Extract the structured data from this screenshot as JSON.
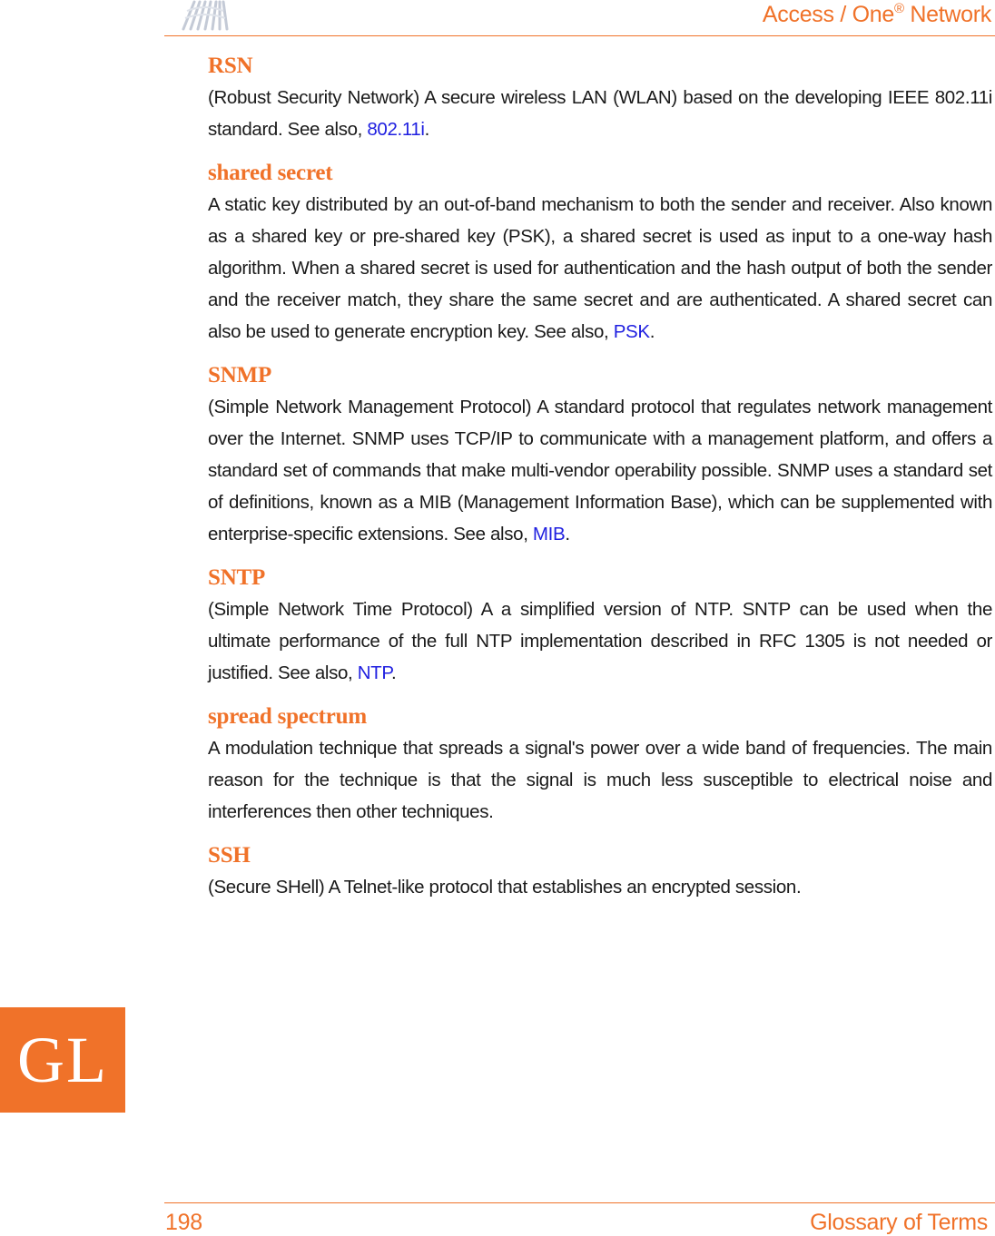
{
  "header": {
    "logo_icon": "fan-wave-logo-icon",
    "title_prefix": "Access / One",
    "title_mark": "®",
    "title_suffix": " Network"
  },
  "entries": [
    {
      "term": "RSN",
      "text": "(Robust Security Network) A secure wireless LAN (WLAN) based on the developing IEEE 802.11i standard. See also, ",
      "link": "802.11i",
      "tail": "."
    },
    {
      "term": "shared secret",
      "text": "A static key distributed by an out-of-band mechanism to both the sender and receiver. Also known as a shared key or pre-shared key (PSK), a shared secret is used as input to a one-way hash algorithm. When a shared secret is used for authentication and the hash output of both the sender and the receiver match, they share the same secret and are authenticated. A shared secret can also be used to generate encryption key. See also, ",
      "link": "PSK",
      "tail": "."
    },
    {
      "term": "SNMP",
      "text": "(Simple Network Management Protocol) A standard protocol that regulates network management over the Internet. SNMP uses TCP/IP to communicate with a management platform, and offers a standard set of commands that make multi-vendor operability possible. SNMP uses a standard set of definitions, known as a MIB (Management Information Base), which can be supplemented with enterprise-specific extensions. See also, ",
      "link": "MIB",
      "tail": "."
    },
    {
      "term": "SNTP",
      "text": "(Simple Network Time Protocol) A a simplified version of NTP. SNTP can be used when the ultimate performance of the full NTP implementation described in RFC 1305 is not needed or justified. See also, ",
      "link": "NTP",
      "tail": "."
    },
    {
      "term": "spread spectrum",
      "text": "A modulation technique that spreads a signal's power over a wide band of frequencies. The main reason for the technique is that the signal is much less susceptible to electrical noise and interferences then other techniques.",
      "link": null,
      "tail": ""
    },
    {
      "term": "SSH",
      "text": "(Secure SHell) A Telnet-like protocol that establishes an encrypted session.",
      "link": null,
      "tail": ""
    }
  ],
  "side_tab": {
    "label": "GL"
  },
  "footer": {
    "page_number": "198",
    "section": "Glossary of Terms"
  },
  "colors": {
    "accent": "#f07229",
    "link": "#1f1fe0",
    "body_text": "#1a1a1a"
  }
}
